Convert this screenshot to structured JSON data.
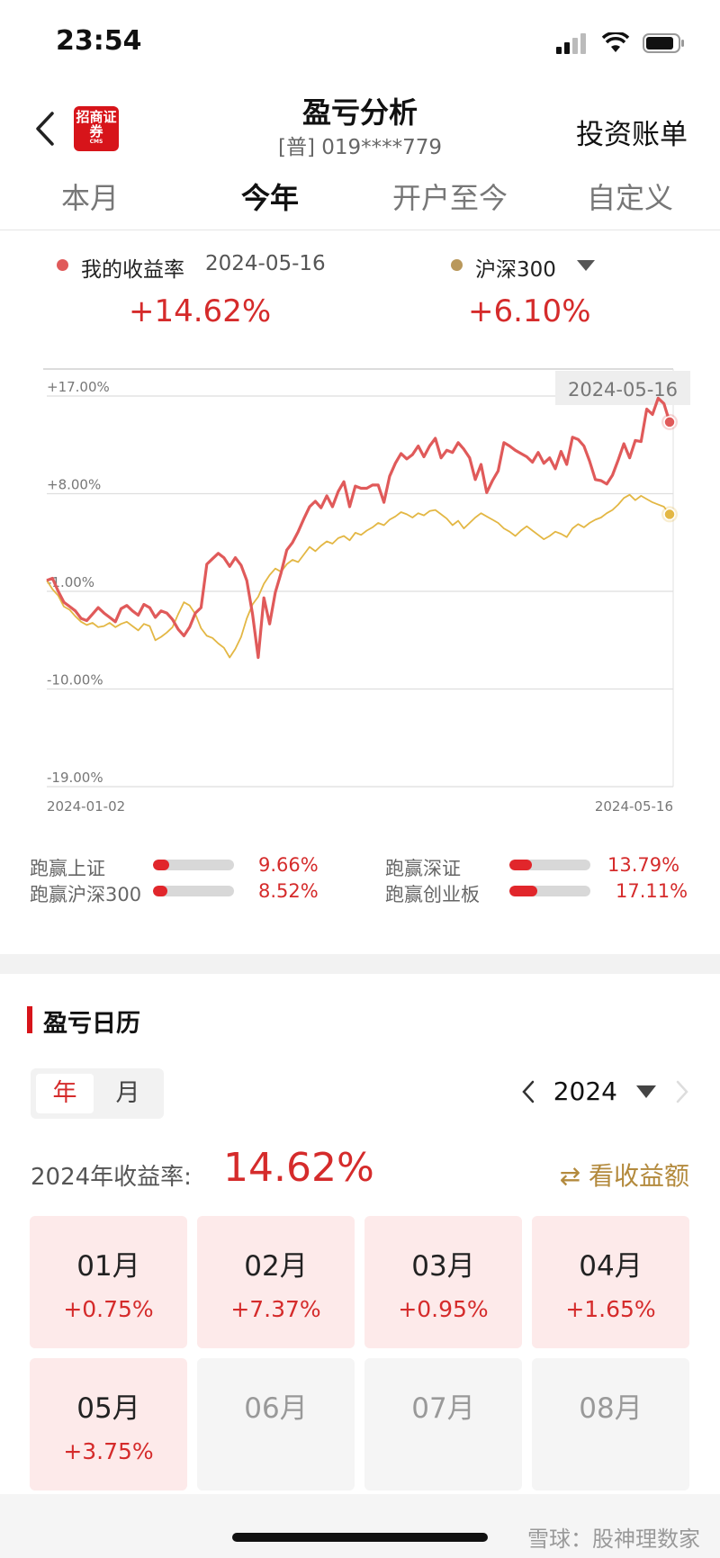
{
  "status": {
    "time": "23:54"
  },
  "header": {
    "title": "盈亏分析",
    "subtitle": "[普] 019****779",
    "logo_text": "招商证券",
    "logo_sub": "CMS",
    "right_link": "投资账单"
  },
  "tabs": [
    {
      "label": "本月"
    },
    {
      "label": "今年"
    },
    {
      "label": "开户至今"
    },
    {
      "label": "自定义"
    }
  ],
  "legend": {
    "mine_label": "我的收益率",
    "mine_date": "2024-05-16",
    "mine_value": "+14.62%",
    "bench_label": "沪深300",
    "bench_value": "+6.10%"
  },
  "chart_data": {
    "type": "line",
    "date_tag": "2024-05-16",
    "x_start_label": "2024-01-02",
    "x_end_label": "2024-05-16",
    "y_tick_labels": [
      "+17.00%",
      "+8.00%",
      "-1.00%",
      "-10.00%",
      "-19.00%"
    ],
    "ylim": [
      -19,
      17
    ],
    "grid": true,
    "colors": {
      "mine": "#e05a5a",
      "bench": "#e3b744"
    },
    "series": [
      {
        "name": "我的收益率",
        "values": [
          0,
          0.2,
          -1,
          -2,
          -2.4,
          -2.8,
          -3.5,
          -3.7,
          -3.1,
          -2.5,
          -3,
          -3.4,
          -3.8,
          -2.6,
          -2.3,
          -2.8,
          -3.2,
          -2.2,
          -2.5,
          -3.4,
          -2.8,
          -3,
          -3.6,
          -4.5,
          -5.1,
          -4.3,
          -3,
          -2.5,
          1.5,
          2,
          2.5,
          2.1,
          1.3,
          2.1,
          1.4,
          0,
          -3.1,
          -7.1,
          -1.6,
          -4,
          -1.1,
          0.7,
          2.8,
          3.5,
          4.5,
          5.7,
          6.8,
          7.3,
          6.7,
          7.8,
          6.8,
          8.2,
          9.1,
          6.8,
          8.7,
          8.5,
          8.5,
          8.8,
          8.8,
          7.2,
          9.6,
          10.8,
          11.7,
          11.2,
          11.6,
          12.4,
          11.4,
          12.4,
          13.1,
          11.3,
          12,
          11.8,
          12.7,
          12.1,
          11.3,
          9.3,
          10.7,
          8.1,
          9.2,
          10.1,
          12.7,
          12.4,
          12,
          11.7,
          11.4,
          10.9,
          11.8,
          10.8,
          11.3,
          10.3,
          11.9,
          10.7,
          13.2,
          13,
          12.4,
          11,
          9.3,
          9.2,
          8.9,
          9.7,
          11.1,
          12.6,
          11.3,
          12.9,
          12.8,
          15.8,
          15.3,
          16.8,
          16.3,
          14.6
        ]
      },
      {
        "name": "沪深300",
        "values": [
          0,
          -0.8,
          -1.4,
          -2.4,
          -2.7,
          -3.3,
          -3.8,
          -4.1,
          -3.9,
          -4.3,
          -4.2,
          -3.9,
          -4.3,
          -4,
          -3.8,
          -4.2,
          -4.6,
          -4,
          -4.2,
          -5.5,
          -5.2,
          -4.8,
          -4.3,
          -3.1,
          -2,
          -2.3,
          -3.1,
          -4.4,
          -5.1,
          -5.3,
          -5.8,
          -6.2,
          -7.1,
          -6.3,
          -5.2,
          -3.5,
          -2.2,
          -1.5,
          -0.3,
          0.5,
          1.1,
          0.8,
          1.5,
          1.9,
          1.7,
          2.4,
          3.1,
          2.7,
          3.2,
          3.6,
          3.4,
          3.9,
          4.1,
          3.7,
          4.4,
          4.2,
          4.6,
          4.9,
          5.3,
          5.1,
          5.6,
          5.9,
          6.3,
          6.1,
          5.8,
          6.2,
          6,
          6.4,
          6.5,
          6.1,
          5.7,
          5.1,
          5.5,
          4.8,
          5.3,
          5.8,
          6.2,
          5.9,
          5.6,
          5.3,
          4.8,
          4.5,
          4.1,
          4.6,
          5,
          4.6,
          4.2,
          3.8,
          4.1,
          4.5,
          4.3,
          4,
          4.8,
          5.2,
          4.9,
          5.3,
          5.6,
          5.8,
          6.2,
          6.5,
          7,
          7.6,
          7.9,
          7.4,
          7.8,
          7.5,
          7.2,
          7,
          6.8,
          6.1
        ]
      }
    ]
  },
  "beats": [
    {
      "label": "跑赢上证",
      "value": "9.66%",
      "fill": 0.2
    },
    {
      "label": "跑赢深证",
      "value": "13.79%",
      "fill": 0.28
    },
    {
      "label": "跑赢沪深300",
      "value": "8.52%",
      "fill": 0.18
    },
    {
      "label": "跑赢创业板",
      "value": "17.11%",
      "fill": 0.34
    }
  ],
  "calendar": {
    "title": "盈亏日历",
    "seg_year": "年",
    "seg_month": "月",
    "year": "2024",
    "year_label": "2024年收益率:",
    "year_pct": "14.62%",
    "switch_label": "⇄ 看收益额",
    "months": [
      {
        "name": "01月",
        "pct": "+0.75%"
      },
      {
        "name": "02月",
        "pct": "+7.37%"
      },
      {
        "name": "03月",
        "pct": "+0.95%"
      },
      {
        "name": "04月",
        "pct": "+1.65%"
      },
      {
        "name": "05月",
        "pct": "+3.75%"
      },
      {
        "name": "06月",
        "pct": ""
      },
      {
        "name": "07月",
        "pct": ""
      },
      {
        "name": "08月",
        "pct": ""
      }
    ]
  },
  "watermark": "雪球：股神理数家"
}
